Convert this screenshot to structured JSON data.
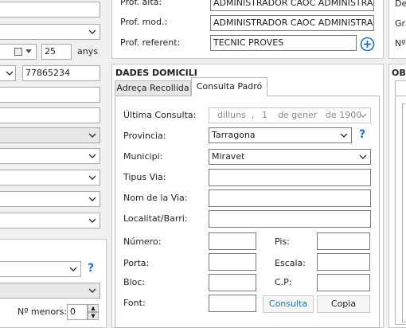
{
  "left": {
    "age_value": "25",
    "age_unit": "anys",
    "id_value": "77865234",
    "menors_label": "Nº menors:",
    "menors_value": "0"
  },
  "prof": {
    "alta_label": "Prof. alta:",
    "alta_value": "ADMINISTRADOR CAOC ADMINISTRAD",
    "mod_label": "Prof. mod.:",
    "mod_value": "ADMINISTRADOR CAOC ADMINISTRAD",
    "ref_label": "Prof. referent:",
    "ref_value": "TECNIC PROVES"
  },
  "right": {
    "de_label": "De",
    "gra_label": "Gra",
    "no_label": "Nº",
    "obs_label": "OBS"
  },
  "domicili": {
    "title": "DADES DOMICILI",
    "tabs": [
      "Adreça Recollida",
      "Consulta Padró"
    ],
    "ultima_label": "Última Consulta:",
    "ultima_day": "dilluns",
    "ultima_sep": ",",
    "ultima_date": "1",
    "ultima_month": "de gener",
    "ultima_year": "de 1900",
    "provincia_label": "Provincia:",
    "provincia_value": "Tarragona",
    "municipi_label": "Municipi:",
    "municipi_value": "Miravet",
    "tipus_label": "Tipus Via:",
    "nom_label": "Nom de la Via:",
    "localitat_label": "Localitat/Barri:",
    "numero_label": "Número:",
    "pis_label": "Pis:",
    "porta_label": "Porta:",
    "escala_label": "Escala:",
    "bloc_label": "Bloc:",
    "cp_label": "C.P:",
    "font_label": "Font:",
    "consulta_button": "Consulta",
    "copia_button": "Copia",
    "help_glyph": "?"
  }
}
